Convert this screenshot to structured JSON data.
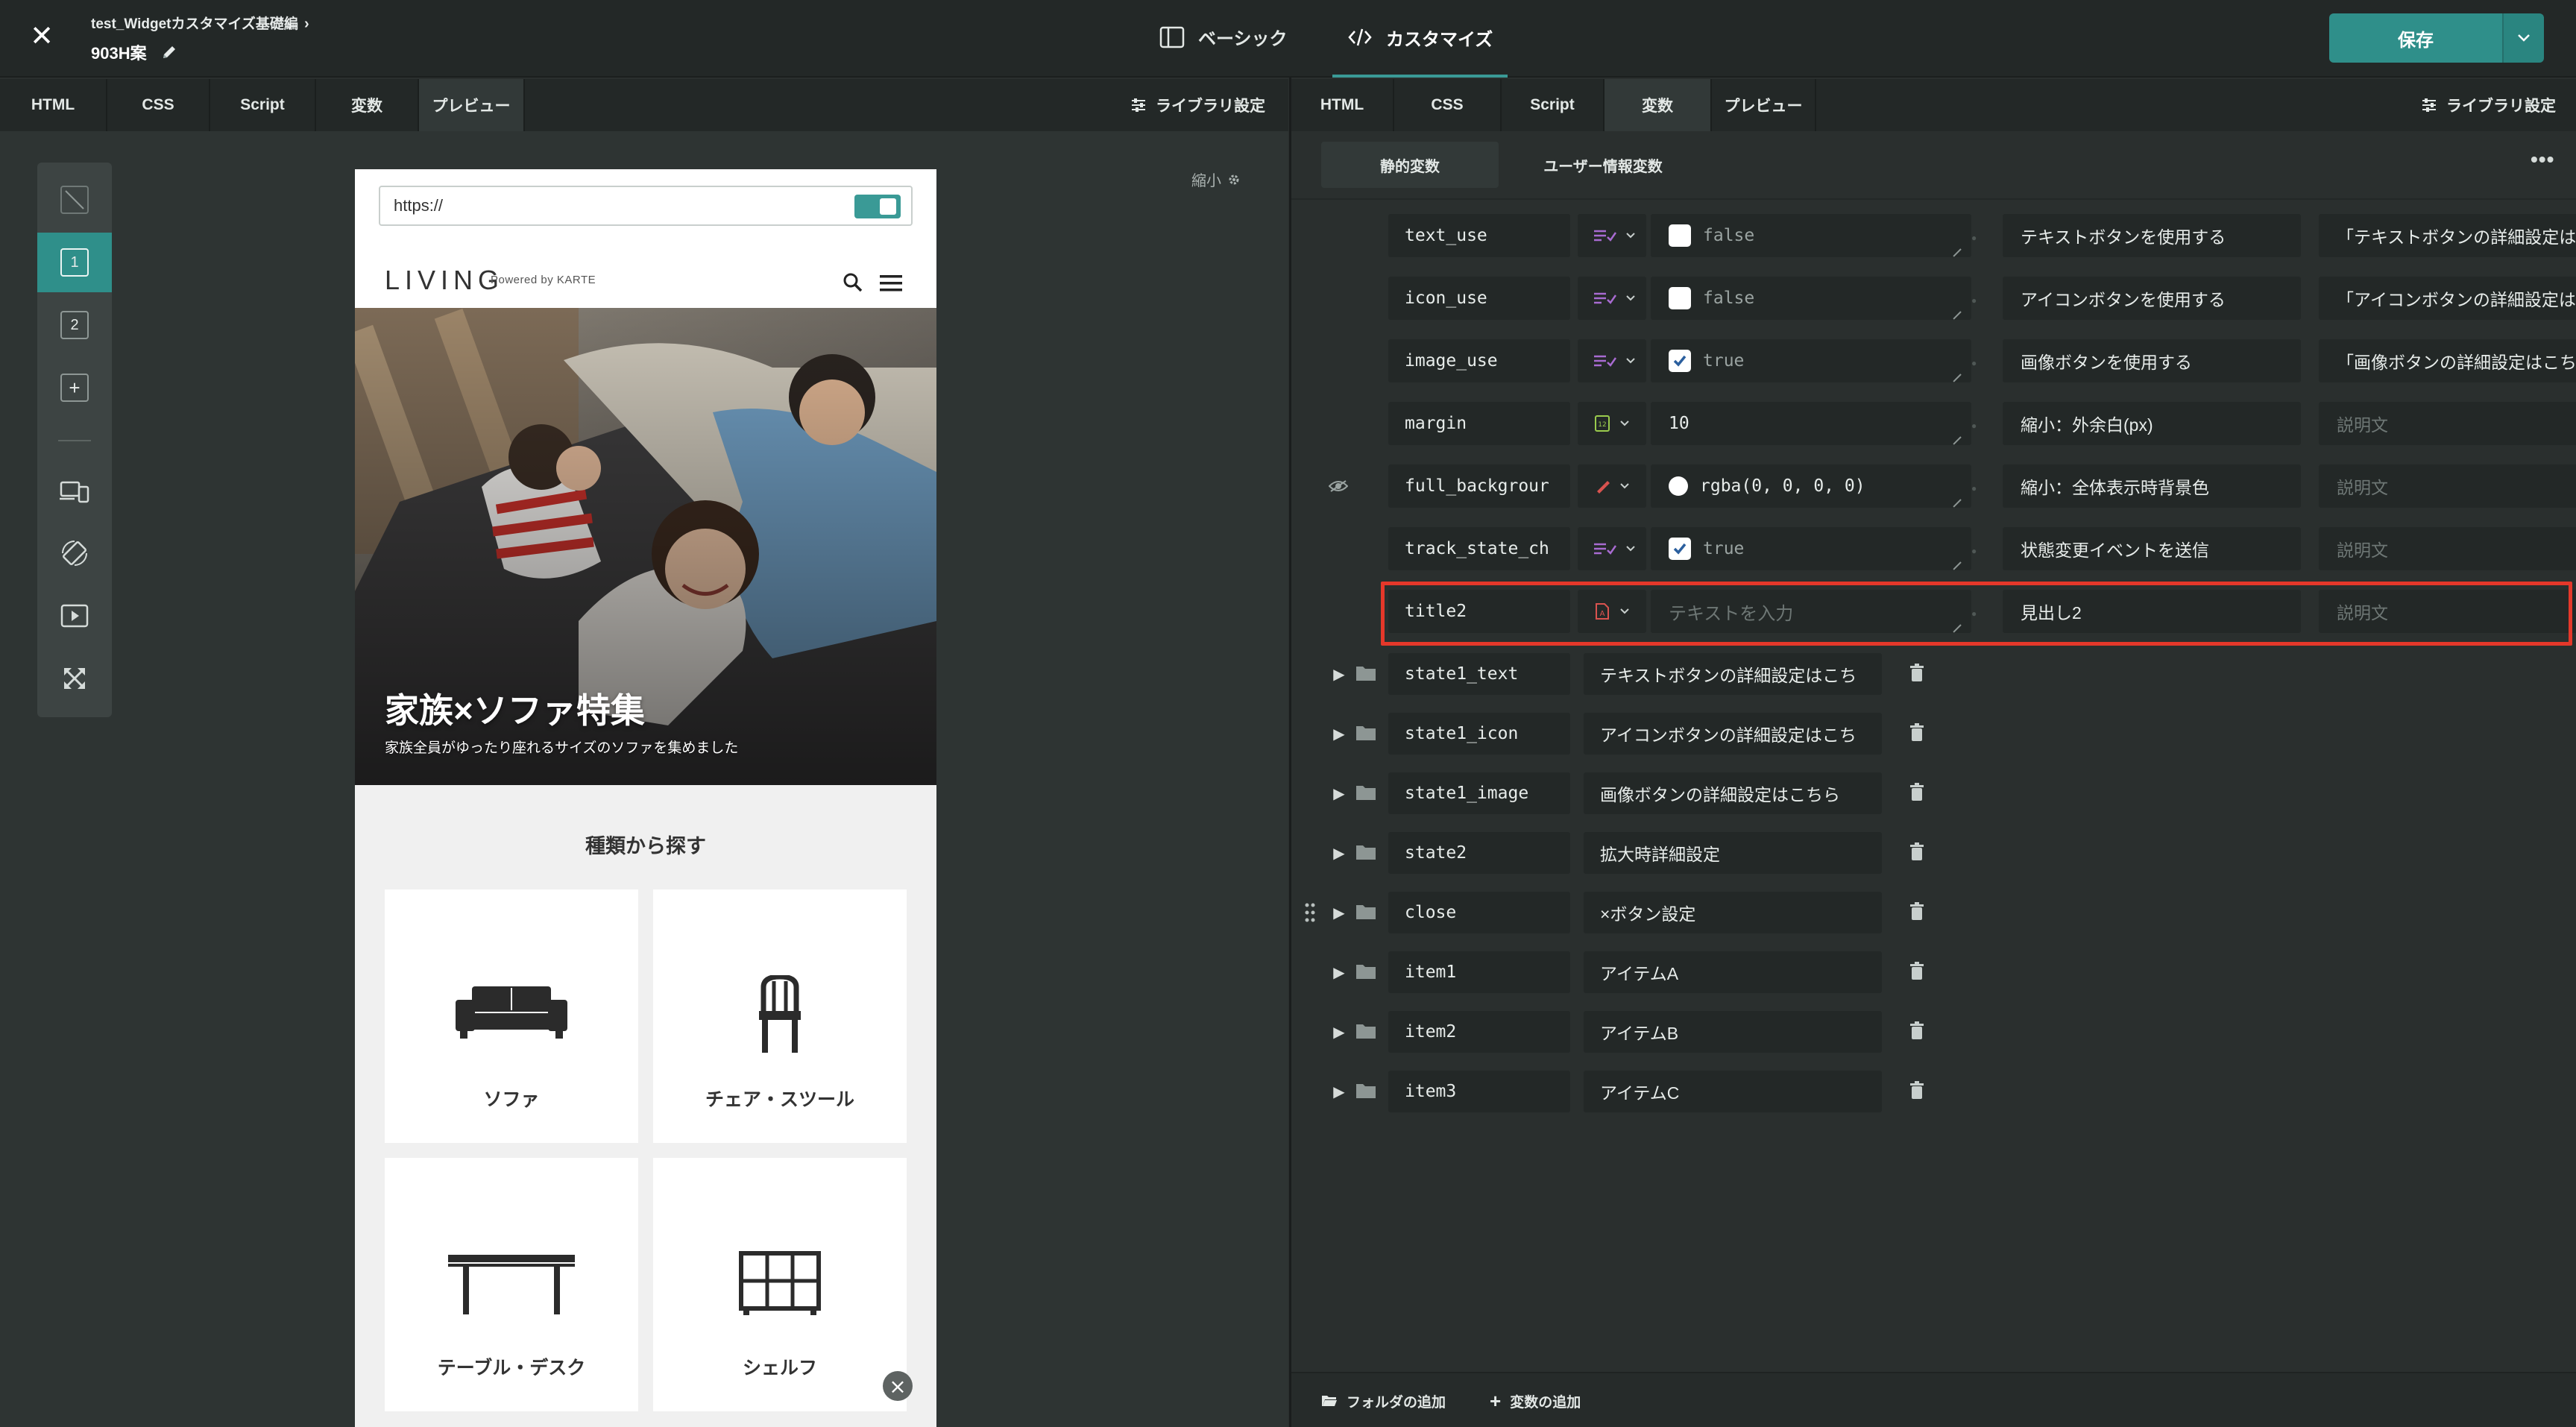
{
  "header": {
    "breadcrumb": "test_Widgetカスタマイズ基礎編",
    "project_name": "903H案",
    "mode_basic": "ベーシック",
    "mode_custom": "カスタマイズ",
    "save_label": "保存"
  },
  "left_tabs": [
    "HTML",
    "CSS",
    "Script",
    "変数",
    "プレビュー"
  ],
  "left_library": "ライブラリ設定",
  "right_tabs": [
    "HTML",
    "CSS",
    "Script",
    "変数",
    "プレビュー"
  ],
  "right_library": "ライブラリ設定",
  "toolstrip": {
    "state1": "1",
    "state2": "2",
    "add": "+"
  },
  "shrink_label": "縮小",
  "preview": {
    "url": "https://",
    "logo": "LIVING",
    "logo_sub": "Powered by KARTE",
    "hero_title": "家族×ソファ特集",
    "hero_sub": "家族全員がゆったり座れるサイズのソファを集めました",
    "category_heading": "種類から探す",
    "categories": [
      "ソファ",
      "チェア・スツール",
      "テーブル・デスク",
      "シェルフ"
    ]
  },
  "variable_tabs": {
    "static": "静的変数",
    "user": "ユーザー情報変数"
  },
  "variables": [
    {
      "name": "text_use",
      "value": "false",
      "desc": "テキストボタンを使用する",
      "note": "「テキストボタンの詳細設定は"
    },
    {
      "name": "icon_use",
      "value": "false",
      "desc": "アイコンボタンを使用する",
      "note": "「アイコンボタンの詳細設定は"
    },
    {
      "name": "image_use",
      "value": "true",
      "desc": "画像ボタンを使用する",
      "note": "「画像ボタンの詳細設定はこち"
    },
    {
      "name": "margin",
      "value": "10",
      "desc": "縮小：外余白(px)",
      "note": "説明文"
    },
    {
      "name": "full_backgrour",
      "value": "rgba(0, 0, 0, 0)",
      "desc": "縮小：全体表示時背景色",
      "note": "説明文"
    },
    {
      "name": "track_state_ch",
      "value": "true",
      "desc": "状態変更イベントを送信",
      "note": "説明文"
    },
    {
      "name": "title2",
      "value": "テキストを入力",
      "desc": "見出し2",
      "note": "説明文"
    }
  ],
  "folders": [
    {
      "name": "state1_text",
      "desc": "テキストボタンの詳細設定はこち"
    },
    {
      "name": "state1_icon",
      "desc": "アイコンボタンの詳細設定はこち"
    },
    {
      "name": "state1_image",
      "desc": "画像ボタンの詳細設定はこちら"
    },
    {
      "name": "state2",
      "desc": "拡大時詳細設定"
    },
    {
      "name": "close",
      "desc": "×ボタン設定"
    },
    {
      "name": "item1",
      "desc": "アイテムA"
    },
    {
      "name": "item2",
      "desc": "アイテムB"
    },
    {
      "name": "item3",
      "desc": "アイテムC"
    }
  ],
  "bottom": {
    "add_folder": "フォルダの追加",
    "add_variable": "変数の追加"
  },
  "colors": {
    "accent": "#2f8f8a",
    "highlight": "#e5382a",
    "panel": "#232827",
    "background": "#2a2f2e"
  }
}
